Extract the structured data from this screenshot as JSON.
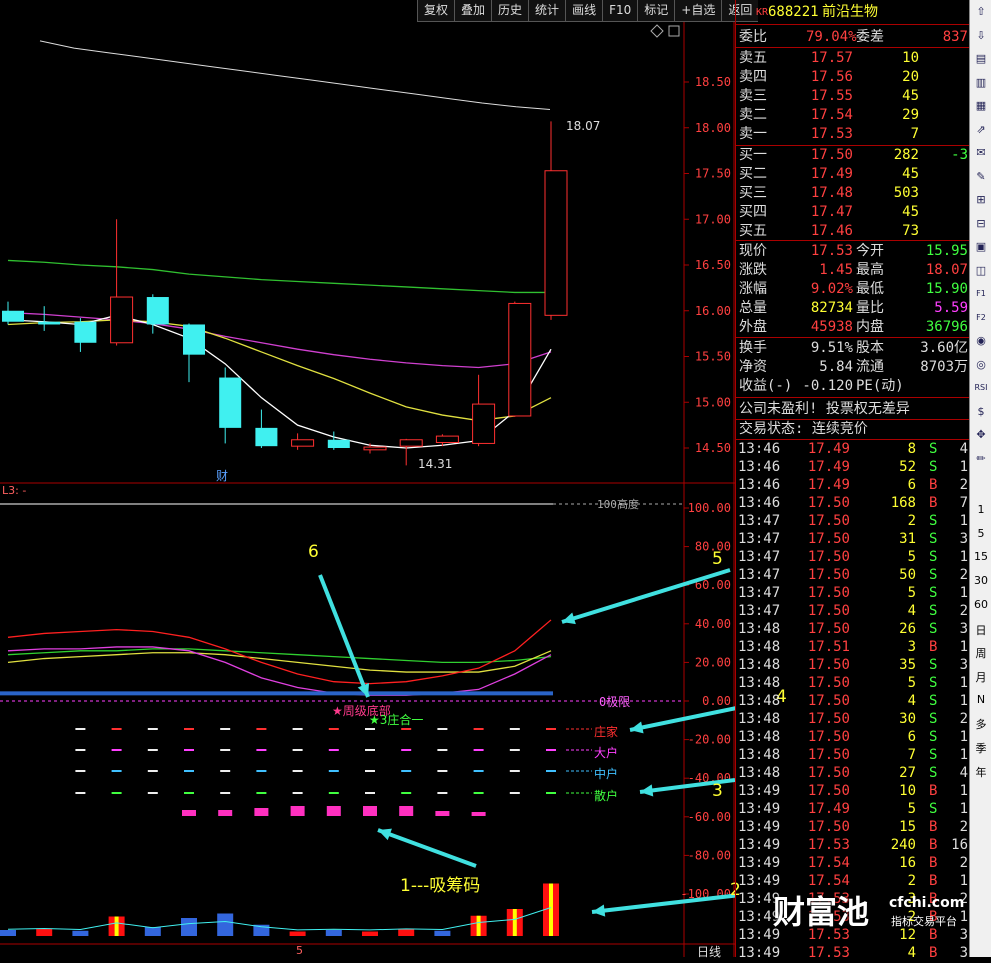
{
  "toolbar": [
    "复权",
    "叠加",
    "历史",
    "统计",
    "画线",
    "F10",
    "标记",
    "+自选",
    "返回"
  ],
  "stock": {
    "market_tag": "KR",
    "code": "688221",
    "name": "前沿生物"
  },
  "ratio": {
    "label1": "委比",
    "value1": "79.04%",
    "label2": "委差",
    "value2": "837"
  },
  "asks": [
    {
      "label": "卖五",
      "price": "17.57",
      "vol": "10"
    },
    {
      "label": "卖四",
      "price": "17.56",
      "vol": "20"
    },
    {
      "label": "卖三",
      "price": "17.55",
      "vol": "45"
    },
    {
      "label": "卖二",
      "price": "17.54",
      "vol": "29"
    },
    {
      "label": "卖一",
      "price": "17.53",
      "vol": "7"
    }
  ],
  "bids": [
    {
      "label": "买一",
      "price": "17.50",
      "vol": "282",
      "chg": "-3"
    },
    {
      "label": "买二",
      "price": "17.49",
      "vol": "45",
      "chg": ""
    },
    {
      "label": "买三",
      "price": "17.48",
      "vol": "503",
      "chg": ""
    },
    {
      "label": "买四",
      "price": "17.47",
      "vol": "45",
      "chg": ""
    },
    {
      "label": "买五",
      "price": "17.46",
      "vol": "73",
      "chg": ""
    }
  ],
  "quote": [
    {
      "l1": "现价",
      "v1": "17.53",
      "l2": "今开",
      "v2": "15.95",
      "c1": "#ff4040",
      "c2": "#40ff40"
    },
    {
      "l1": "涨跌",
      "v1": "1.45",
      "l2": "最高",
      "v2": "18.07",
      "c1": "#ff4040",
      "c2": "#ff4040"
    },
    {
      "l1": "涨幅",
      "v1": "9.02%",
      "l2": "最低",
      "v2": "15.90",
      "c1": "#ff4040",
      "c2": "#40ff40"
    },
    {
      "l1": "总量",
      "v1": "82734",
      "l2": "量比",
      "v2": "5.59",
      "c1": "#ffff33",
      "c2": "#ff40ff"
    },
    {
      "l1": "外盘",
      "v1": "45938",
      "l2": "内盘",
      "v2": "36796",
      "c1": "#ff4040",
      "c2": "#40ff40"
    }
  ],
  "finance": [
    {
      "l1": "换手",
      "v1": "9.51%",
      "l2": "股本",
      "v2": "3.60亿"
    },
    {
      "l1": "净资",
      "v1": "5.84",
      "l2": "流通",
      "v2": "8703万"
    },
    {
      "l1": "收益(-)",
      "v1": "-0.120",
      "l2": "PE(动)",
      "v2": ""
    }
  ],
  "notice1": "公司未盈利! 投票权无差异",
  "notice2": "交易状态: 连续竞价",
  "ticks": [
    [
      "13:46",
      "17.49",
      "8",
      "S",
      "4"
    ],
    [
      "13:46",
      "17.49",
      "52",
      "S",
      "1"
    ],
    [
      "13:46",
      "17.49",
      "6",
      "B",
      "2"
    ],
    [
      "13:46",
      "17.50",
      "168",
      "B",
      "7"
    ],
    [
      "13:47",
      "17.50",
      "2",
      "S",
      "1"
    ],
    [
      "13:47",
      "17.50",
      "31",
      "S",
      "3"
    ],
    [
      "13:47",
      "17.50",
      "5",
      "S",
      "1"
    ],
    [
      "13:47",
      "17.50",
      "50",
      "S",
      "2"
    ],
    [
      "13:47",
      "17.50",
      "5",
      "S",
      "1"
    ],
    [
      "13:47",
      "17.50",
      "4",
      "S",
      "2"
    ],
    [
      "13:48",
      "17.50",
      "26",
      "S",
      "3"
    ],
    [
      "13:48",
      "17.51",
      "3",
      "B",
      "1"
    ],
    [
      "13:48",
      "17.50",
      "35",
      "S",
      "3"
    ],
    [
      "13:48",
      "17.50",
      "5",
      "S",
      "1"
    ],
    [
      "13:48",
      "17.50",
      "4",
      "S",
      "1"
    ],
    [
      "13:48",
      "17.50",
      "30",
      "S",
      "2"
    ],
    [
      "13:48",
      "17.50",
      "6",
      "S",
      "1"
    ],
    [
      "13:48",
      "17.50",
      "7",
      "S",
      "1"
    ],
    [
      "13:48",
      "17.50",
      "27",
      "S",
      "4"
    ],
    [
      "13:49",
      "17.50",
      "10",
      "B",
      "1"
    ],
    [
      "13:49",
      "17.49",
      "5",
      "S",
      "1"
    ],
    [
      "13:49",
      "17.50",
      "15",
      "B",
      "2"
    ],
    [
      "13:49",
      "17.53",
      "240",
      "B",
      "16"
    ],
    [
      "13:49",
      "17.54",
      "16",
      "B",
      "2"
    ],
    [
      "13:49",
      "17.54",
      "2",
      "B",
      "1"
    ],
    [
      "13:49",
      "17.53",
      "3",
      "B",
      "2"
    ],
    [
      "13:49",
      "17.53",
      "2",
      "B",
      "1"
    ],
    [
      "13:49",
      "17.53",
      "12",
      "B",
      "3"
    ],
    [
      "13:49",
      "17.53",
      "4",
      "B",
      "3"
    ]
  ],
  "right_tabs": [
    "1",
    "5",
    "15",
    "30",
    "60",
    "日",
    "周",
    "月",
    "N",
    "多",
    "季",
    "年"
  ],
  "main_yticks": [
    "18.50",
    "18.00",
    "17.50",
    "17.00",
    "16.50",
    "16.00",
    "15.50",
    "15.00",
    "14.50"
  ],
  "ind_yticks": [
    "100.00",
    "80.00",
    "60.00",
    "40.00",
    "20.00",
    "0.00",
    "-20.00",
    "-40.00",
    "-60.00",
    "-80.00",
    "-100.00"
  ],
  "ind_title": "L3: -",
  "high_label": "18.07",
  "low_label": "14.31",
  "cai_marker": "财",
  "top_label": "100高度",
  "zero_label": "0极限",
  "series_labels": [
    {
      "text": "庄家",
      "color": "#ff3030"
    },
    {
      "text": "大户",
      "color": "#ff40ff"
    },
    {
      "text": "中户",
      "color": "#40c0ff"
    },
    {
      "text": "散户",
      "color": "#40ff40"
    }
  ],
  "signal1": "★周级底部",
  "signal2": "★3庄合一",
  "annotations": [
    "6",
    "5",
    "4",
    "3",
    "2",
    "1---吸筹码"
  ],
  "bottom_label": "日线",
  "date_tick": "5",
  "watermark": {
    "brand": "财富池",
    "site": "cfchi.com",
    "slogan": "指标交易平台"
  },
  "colors": {
    "up": "#ff3030",
    "down": "#40f0f0",
    "frame": "#aa0000",
    "accent": "#ffff33"
  },
  "chart_data": {
    "type": "candlestick",
    "candles": [
      {
        "o": 16.0,
        "h": 16.1,
        "l": 15.85,
        "c": 15.88
      },
      {
        "o": 15.88,
        "h": 16.05,
        "l": 15.78,
        "c": 15.85
      },
      {
        "o": 15.88,
        "h": 15.92,
        "l": 15.55,
        "c": 15.65
      },
      {
        "o": 15.65,
        "h": 17.0,
        "l": 15.62,
        "c": 16.15
      },
      {
        "o": 16.15,
        "h": 16.18,
        "l": 15.75,
        "c": 15.85
      },
      {
        "o": 15.85,
        "h": 15.86,
        "l": 15.22,
        "c": 15.52
      },
      {
        "o": 15.27,
        "h": 15.38,
        "l": 14.55,
        "c": 14.72
      },
      {
        "o": 14.72,
        "h": 14.92,
        "l": 14.5,
        "c": 14.52
      },
      {
        "o": 14.52,
        "h": 14.66,
        "l": 14.48,
        "c": 14.59
      },
      {
        "o": 14.59,
        "h": 14.68,
        "l": 14.48,
        "c": 14.5
      },
      {
        "o": 14.48,
        "h": 14.55,
        "l": 14.44,
        "c": 14.51
      },
      {
        "o": 14.52,
        "h": 14.6,
        "l": 14.31,
        "c": 14.59
      },
      {
        "o": 14.56,
        "h": 14.65,
        "l": 14.52,
        "c": 14.63
      },
      {
        "o": 14.55,
        "h": 15.3,
        "l": 14.52,
        "c": 14.98
      },
      {
        "o": 14.85,
        "h": 16.1,
        "l": 14.84,
        "c": 16.08
      },
      {
        "o": 15.95,
        "h": 18.07,
        "l": 15.9,
        "c": 17.53
      }
    ],
    "ma_long": [
      16.55,
      16.53,
      16.5,
      16.48,
      16.45,
      16.4,
      16.37,
      16.34,
      16.32,
      16.3,
      16.28,
      16.26,
      16.24,
      16.22,
      16.2,
      16.2
    ],
    "ma_mid": [
      15.98,
      15.96,
      15.93,
      15.9,
      15.86,
      15.8,
      15.72,
      15.65,
      15.58,
      15.52,
      15.47,
      15.43,
      15.4,
      15.38,
      15.42,
      15.55
    ],
    "ma_short": [
      15.85,
      15.87,
      15.88,
      15.9,
      15.88,
      15.83,
      15.7,
      15.55,
      15.4,
      15.26,
      15.1,
      14.95,
      14.86,
      14.8,
      14.85,
      15.05
    ],
    "ma_fast": [
      15.9,
      15.88,
      15.85,
      15.95,
      15.85,
      15.7,
      15.42,
      15.05,
      14.75,
      14.62,
      14.53,
      14.5,
      14.53,
      14.58,
      14.9,
      15.58
    ],
    "ma_top": [
      18.95,
      18.87,
      18.82,
      18.77,
      18.72,
      18.67,
      18.62,
      18.57,
      18.52,
      18.47,
      18.42,
      18.37,
      18.32,
      18.27,
      18.23,
      18.2
    ],
    "ind_red": [
      33,
      35,
      36,
      37,
      36,
      33,
      27,
      20,
      14,
      10,
      9,
      10,
      13,
      17,
      26,
      42
    ],
    "ind_magenta": [
      26,
      27,
      27,
      28,
      28,
      26,
      20,
      12,
      7,
      4,
      3,
      3,
      4,
      6,
      14,
      24
    ],
    "ind_yellow": [
      20,
      22,
      23,
      24,
      25,
      25,
      24,
      22,
      20,
      18,
      16,
      15,
      15,
      15,
      18,
      26
    ],
    "ind_green": [
      24,
      25,
      26,
      26,
      27,
      27,
      26,
      25,
      24,
      23,
      22,
      21,
      20,
      20,
      21,
      23
    ],
    "volume": [
      {
        "v": 8,
        "u": false
      },
      {
        "v": 10,
        "u": true
      },
      {
        "v": 7,
        "u": false
      },
      {
        "v": 26,
        "u": true
      },
      {
        "v": 12,
        "u": false
      },
      {
        "v": 24,
        "u": false
      },
      {
        "v": 30,
        "u": false
      },
      {
        "v": 15,
        "u": false
      },
      {
        "v": 6,
        "u": true
      },
      {
        "v": 8,
        "u": false
      },
      {
        "v": 6,
        "u": true
      },
      {
        "v": 9,
        "u": true
      },
      {
        "v": 7,
        "u": false
      },
      {
        "v": 27,
        "u": true
      },
      {
        "v": 36,
        "u": true
      },
      {
        "v": 70,
        "u": true
      }
    ],
    "absorb": [
      0,
      0,
      0,
      0,
      0,
      6,
      6,
      8,
      10,
      10,
      10,
      10,
      5,
      4,
      0,
      0
    ],
    "main_ylim": [
      14.2,
      19.0
    ],
    "ind_ylim": [
      -100,
      100
    ]
  }
}
